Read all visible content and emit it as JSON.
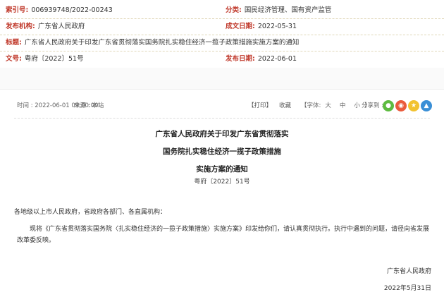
{
  "meta": {
    "index_label": "索引号:",
    "index_value": "006939748/2022-00243",
    "category_label": "分类:",
    "category_value": "国民经济管理、国有资产监管",
    "publisher_label": "发布机构:",
    "publisher_value": "广东省人民政府",
    "written_label": "成文日期:",
    "written_value": "2022-05-31",
    "title_label": "标题:",
    "title_value": "广东省人民政府关于印发广东省贯彻落实国务院扎实稳住经济一揽子政策措施实施方案的通知",
    "docno_label": "文号:",
    "docno_value": "粤府〔2022〕51号",
    "pubdate_label": "发布日期:",
    "pubdate_value": "2022-06-01"
  },
  "toolbar": {
    "time": "时间 : 2022-06-01 09:00:00",
    "source": "来源 : 本站",
    "print": "【打印】",
    "favorite": "收藏",
    "font_prefix": "【字体:",
    "font_large": "大",
    "font_medium": "中",
    "font_small": "小",
    "font_suffix": "】",
    "share": "分享到 :",
    "share_icons": [
      "wechat-icon",
      "weibo-icon",
      "qzone-icon",
      "more-share-icon"
    ]
  },
  "article": {
    "title_line1": "广东省人民政府关于印发广东省贯彻落实",
    "title_line2": "国务院扎实稳住经济一揽子政策措施",
    "title_line3": "实施方案的通知",
    "doc_number": "粤府〔2022〕51号",
    "salutation": "各地级以上市人民政府，省政府各部门、各直属机构：",
    "paragraph1": "　　现将《广东省贯彻落实国务院〈扎实稳住经济的一揽子政策措施〉实施方案》印发给你们，请认真贯彻执行。执行中遇到的问题，请径向省发展改革委反映。",
    "signature": "广东省人民政府",
    "signature_date": "2022年5月31日"
  }
}
